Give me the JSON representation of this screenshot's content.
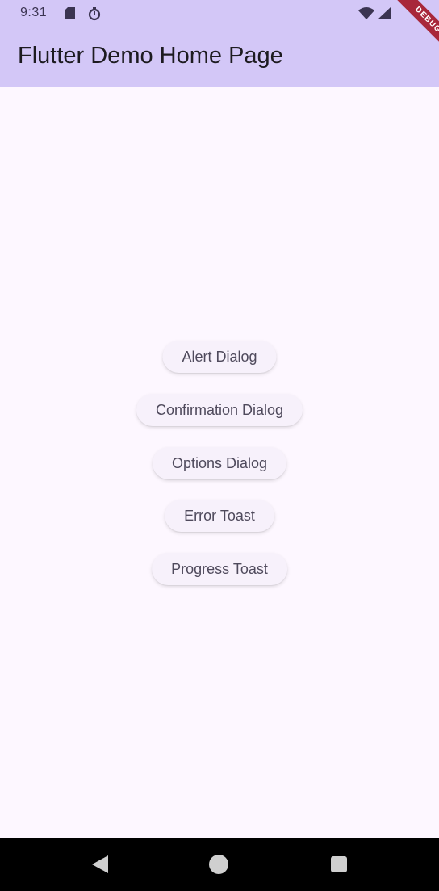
{
  "status_bar": {
    "time": "9:31",
    "icons": [
      "sd-card-icon",
      "sync-icon",
      "wifi-icon",
      "signal-icon"
    ]
  },
  "app_bar": {
    "title": "Flutter Demo Home Page",
    "debug_banner": "DEBUG"
  },
  "buttons": [
    {
      "label": "Alert Dialog"
    },
    {
      "label": "Confirmation Dialog"
    },
    {
      "label": "Options Dialog"
    },
    {
      "label": "Error Toast"
    },
    {
      "label": "Progress Toast"
    }
  ],
  "nav_bar": {
    "icons": [
      "back-icon",
      "home-icon",
      "recents-icon"
    ]
  },
  "colors": {
    "app_bar": "#d3c7f7",
    "background": "#fdf7ff",
    "button_background": "#f7f1fb",
    "button_text": "#4f4a5c",
    "debug_banner": "#a8273a",
    "nav_bar": "#000000"
  }
}
